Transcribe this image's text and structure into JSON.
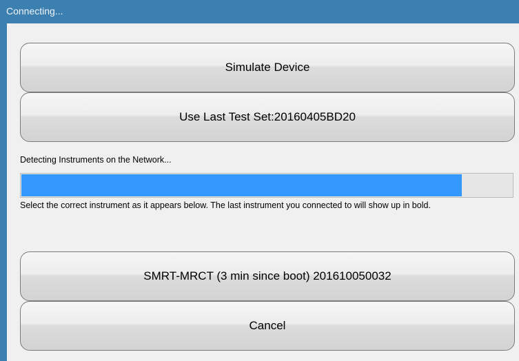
{
  "window": {
    "title": "Connecting..."
  },
  "buttons": {
    "simulate_label": "Simulate Device",
    "last_test_set_label": "Use Last Test Set:20160405BD20",
    "device_label": "SMRT-MRCT (3 min since boot) 201610050032",
    "cancel_label": "Cancel"
  },
  "status": {
    "detecting_text": "Detecting Instruments on the Network...",
    "progress_fraction": 0.897
  },
  "instructions": {
    "text": "Select the correct instrument as it appears below. The last instrument you connected to will show up in bold."
  },
  "colors": {
    "titlebar": "#3c7fb1",
    "progress_fill": "#3399ff",
    "client_bg": "#f0f0f0"
  }
}
